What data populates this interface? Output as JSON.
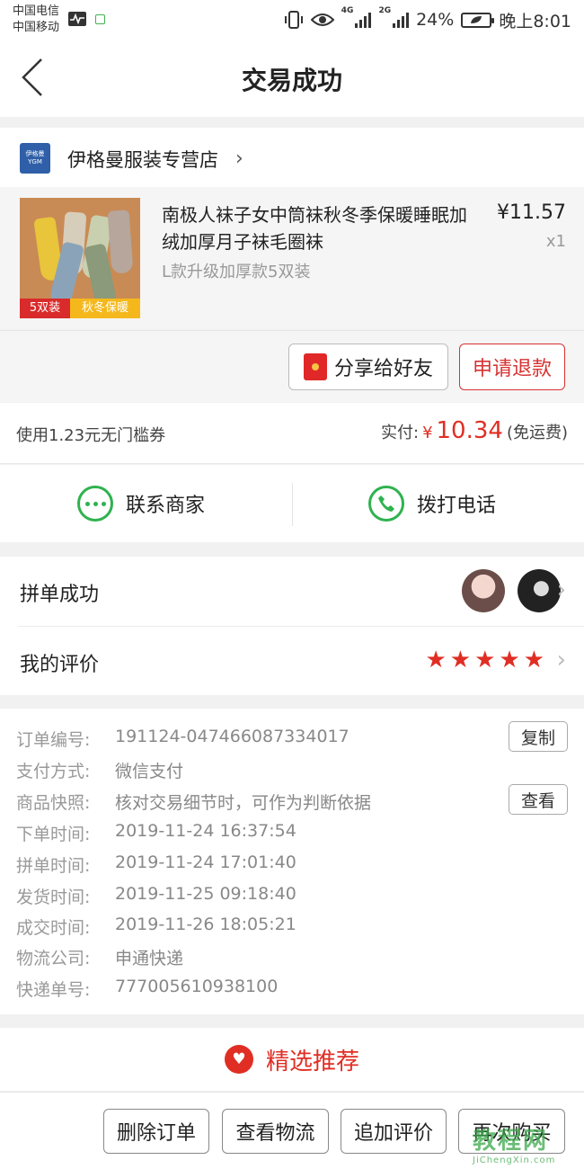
{
  "status_bar": {
    "carrier1": "中国电信",
    "carrier2": "中国移动",
    "net1": "4G",
    "net2": "2G",
    "battery": "24%",
    "time": "晚上8:01"
  },
  "header": {
    "title": "交易成功"
  },
  "store": {
    "logo_text": "伊格曼",
    "logo_sub": "YGM",
    "name": "伊格曼服装专营店"
  },
  "product": {
    "title": "南极人袜子女中筒袜秋冬季保暖睡眠加绒加厚月子袜毛圈袜",
    "variant": "L款升级加厚款5双装",
    "price": "¥11.57",
    "quantity": "x1",
    "tag_left": "5双装",
    "tag_right": "秋冬保暖"
  },
  "actions": {
    "share_label": "分享给好友",
    "refund_label": "申请退款"
  },
  "payment": {
    "coupon": "使用1.23元无门槛券",
    "paid_label": "实付:",
    "currency": "¥",
    "amount": "10.34",
    "shipping": "(免运费)"
  },
  "contact": {
    "merchant_label": "联系商家",
    "call_label": "拨打电话"
  },
  "group": {
    "group_label": "拼单成功",
    "review_label": "我的评价",
    "rating": 5
  },
  "order_info": {
    "order_no_label": "订单编号:",
    "order_no": "191124-047466087334017",
    "pay_method_label": "支付方式:",
    "pay_method": "微信支付",
    "snapshot_label": "商品快照:",
    "snapshot": "核对交易细节时，可作为判断依据",
    "order_time_label": "下单时间:",
    "order_time": "2019-11-24 16:37:54",
    "group_time_label": "拼单时间:",
    "group_time": "2019-11-24 17:01:40",
    "ship_time_label": "发货时间:",
    "ship_time": "2019-11-25 09:18:40",
    "deal_time_label": "成交时间:",
    "deal_time": "2019-11-26 18:05:21",
    "courier_label": "物流公司:",
    "courier": "申通快递",
    "tracking_label": "快递单号:",
    "tracking": "777005610938100",
    "copy_label": "复制",
    "view_label": "查看"
  },
  "recommend": {
    "label": "精选推荐"
  },
  "bottom_bar": {
    "delete": "删除订单",
    "logistics": "查看物流",
    "add_review": "追加评价",
    "buy_again": "再次购买"
  },
  "watermark": {
    "top": "教程网",
    "bottom": "JiChengXin.com"
  },
  "colors": {
    "accent": "#e02e24",
    "green": "#2fb24f"
  }
}
